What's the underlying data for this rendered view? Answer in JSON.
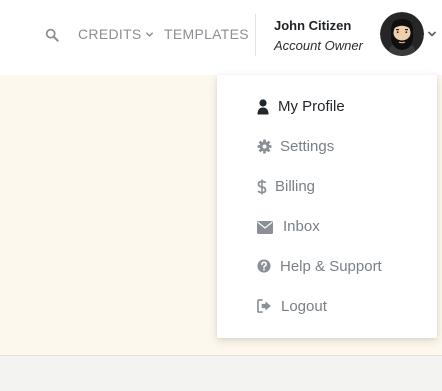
{
  "topbar": {
    "credits_label": "CREDITS",
    "templates_label": "TEMPLATES",
    "icons": {
      "search": "search-icon",
      "credits_chevron": "chevron-down-icon",
      "avatar_chevron": "chevron-down-icon"
    }
  },
  "user": {
    "name": "John Citizen",
    "role": "Account Owner"
  },
  "menu": {
    "items": [
      {
        "label": "My Profile",
        "icon": "user-icon",
        "active": true
      },
      {
        "label": "Settings",
        "icon": "gear-icon",
        "active": false
      },
      {
        "label": "Billing",
        "icon": "dollar-icon",
        "active": false
      },
      {
        "label": "Inbox",
        "icon": "envelope-icon",
        "active": false
      },
      {
        "label": "Help & Support",
        "icon": "question-circle-icon",
        "active": false
      },
      {
        "label": "Logout",
        "icon": "sign-out-icon",
        "active": false
      }
    ]
  },
  "colors": {
    "active_text": "#22272b",
    "inactive_text": "#7a8087",
    "nav_text": "#8a9096",
    "content_background": "#fdf8ee"
  }
}
